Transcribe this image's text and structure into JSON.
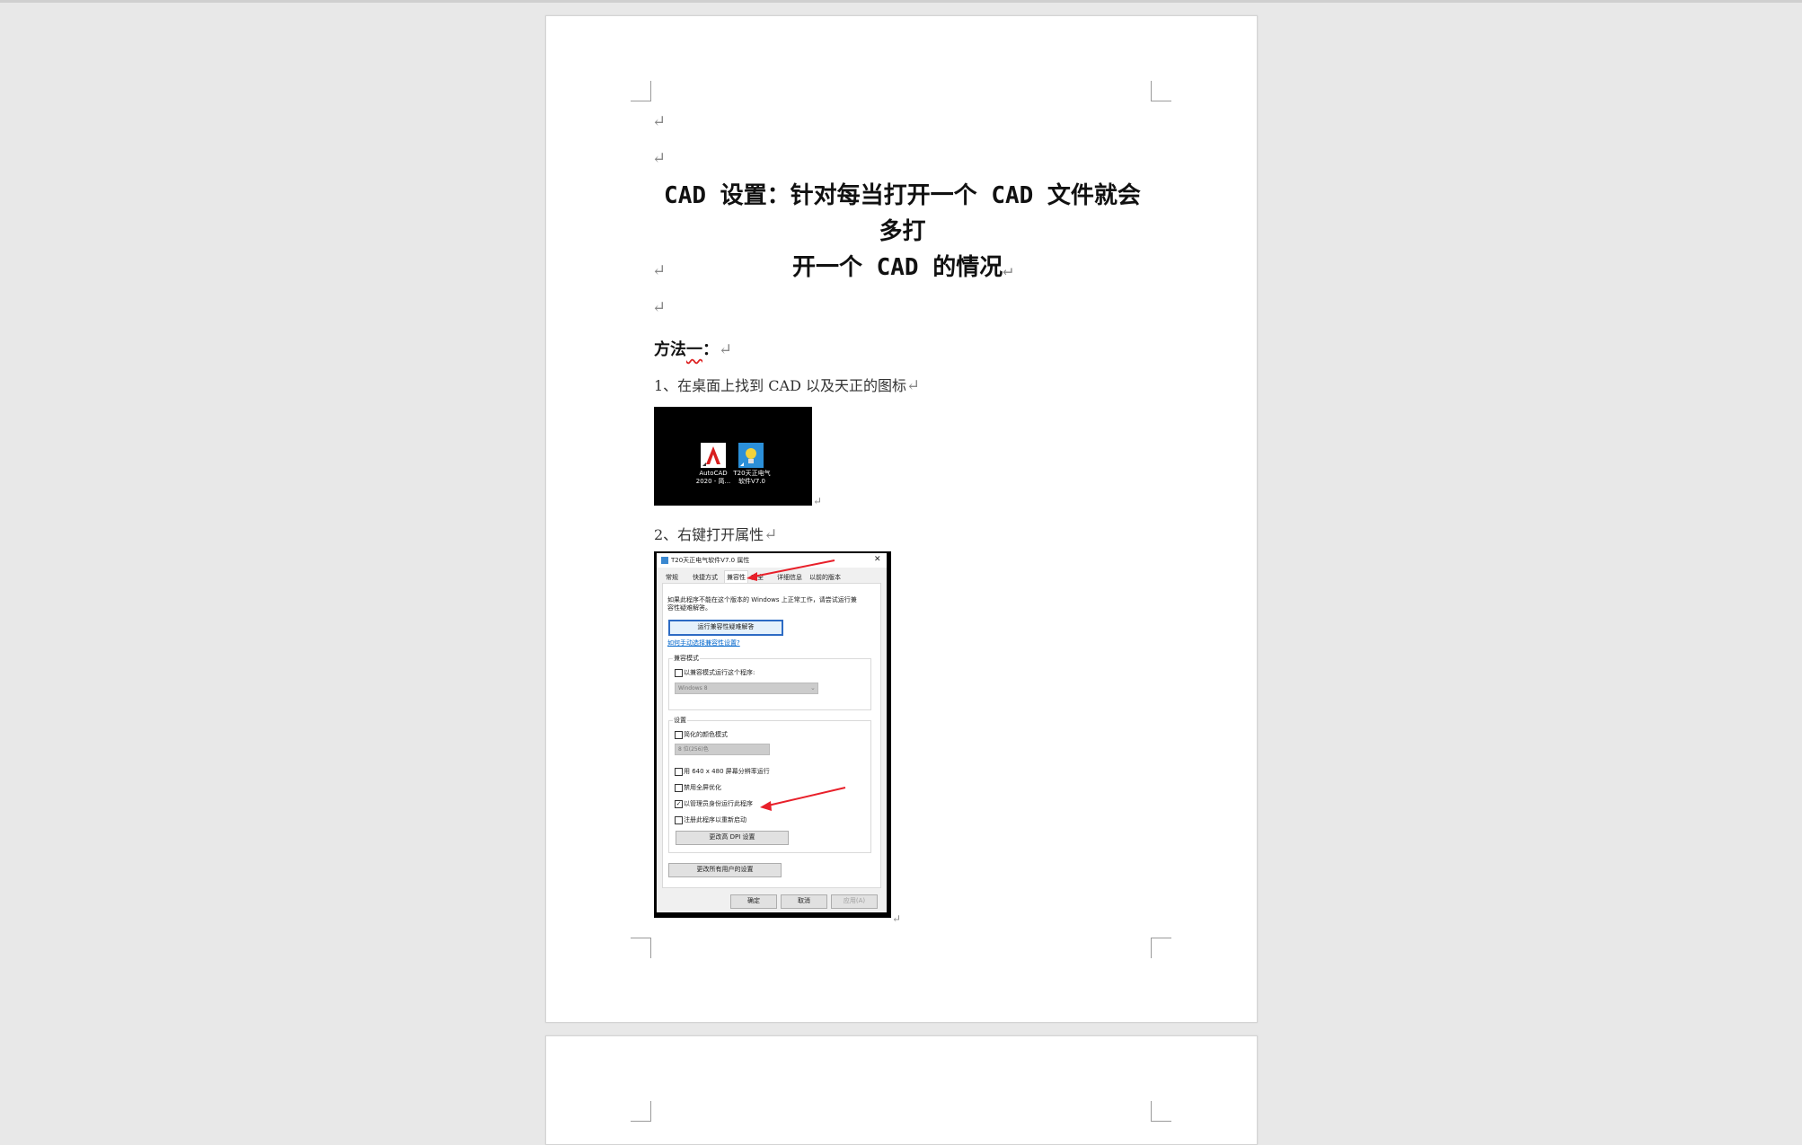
{
  "document": {
    "title_line1": "CAD 设置：针对每当打开一个 CAD 文件就会多打",
    "title_line2": "开一个 CAD 的情况",
    "return_mark": "↵",
    "method_heading": "方法一：",
    "method_heading_ul": "一",
    "step1": "1、在桌面上找到 CAD 以及天正的图标",
    "step2": "2、右键打开属性"
  },
  "desktop_image": {
    "icon1_label_line1": "AutoCAD",
    "icon1_label_line2": "2020 - 简...",
    "icon2_label_line1": "T20天正电气",
    "icon2_label_line2": "软件V7.0"
  },
  "dialog_image": {
    "window_title": "T20天正电气软件V7.0 属性",
    "close": "✕",
    "tabs": [
      "常规",
      "快捷方式",
      "兼容性",
      "安全",
      "详细信息",
      "以前的版本"
    ],
    "intro_line1": "如果此程序不能在这个版本的 Windows 上正常工作，请尝试运行兼",
    "intro_line2": "容性疑难解答。",
    "troubleshoot_button": "运行兼容性疑难解答",
    "manual_link": "如何手动选择兼容性设置?",
    "compat_group": "兼容模式",
    "compat_checkbox": "以兼容模式运行这个程序:",
    "compat_select": "Windows 8",
    "settings_group": "设置",
    "reduced_color": "简化的颜色模式",
    "color_select": "8 位(256)色",
    "resolution": "用 640 x 480 屏幕分辨率运行",
    "fullscreen_opt": "禁用全屏优化",
    "run_as_admin": "以管理员身份运行此程序",
    "run_as_admin_checked": true,
    "register_restart": "注册此程序以重新启动",
    "dpi_button": "更改高 DPI 设置",
    "all_users_button": "更改所有用户的设置",
    "ok_button": "确定",
    "cancel_button": "取消",
    "apply_button": "应用(A)",
    "arrow_color": "#e8202a"
  }
}
